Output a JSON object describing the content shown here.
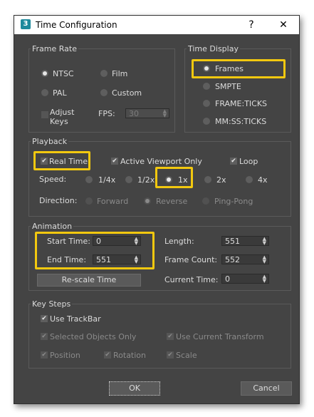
{
  "window": {
    "title": "Time Configuration",
    "app_icon_text": "3",
    "help_label": "?",
    "close_label": "✕"
  },
  "frame_rate": {
    "label": "Frame Rate",
    "options": {
      "ntsc": "NTSC",
      "film": "Film",
      "pal": "PAL",
      "custom": "Custom"
    },
    "selected": "NTSC",
    "adjust_keys": "Adjust\nKeys",
    "fps_label": "FPS:",
    "fps_value": "30"
  },
  "time_display": {
    "label": "Time Display",
    "options": {
      "frames": "Frames",
      "smpte": "SMPTE",
      "frame_ticks": "FRAME:TICKS",
      "mmss_ticks": "MM:SS:TICKS"
    },
    "selected": "Frames"
  },
  "playback": {
    "label": "Playback",
    "real_time": "Real Time",
    "active_viewport_only": "Active Viewport Only",
    "loop": "Loop",
    "speed_label": "Speed:",
    "speeds": {
      "quarter": "1/4x",
      "half": "1/2x",
      "one": "1x",
      "two": "2x",
      "four": "4x"
    },
    "selected_speed": "1x",
    "direction_label": "Direction:",
    "directions": {
      "forward": "Forward",
      "reverse": "Reverse",
      "pingpong": "Ping-Pong"
    }
  },
  "animation": {
    "label": "Animation",
    "start_time_label": "Start Time:",
    "start_time_value": "0",
    "end_time_label": "End Time:",
    "end_time_value": "551",
    "length_label": "Length:",
    "length_value": "551",
    "frame_count_label": "Frame Count:",
    "frame_count_value": "552",
    "current_time_label": "Current Time:",
    "current_time_value": "0",
    "rescale_button": "Re-scale Time"
  },
  "key_steps": {
    "label": "Key Steps",
    "use_trackbar": "Use TrackBar",
    "selected_objects_only": "Selected Objects Only",
    "use_current_transform": "Use Current Transform",
    "position": "Position",
    "rotation": "Rotation",
    "scale": "Scale"
  },
  "buttons": {
    "ok": "OK",
    "cancel": "Cancel"
  },
  "colors": {
    "highlight": "#f2c80f",
    "dialog_bg": "#444444"
  }
}
